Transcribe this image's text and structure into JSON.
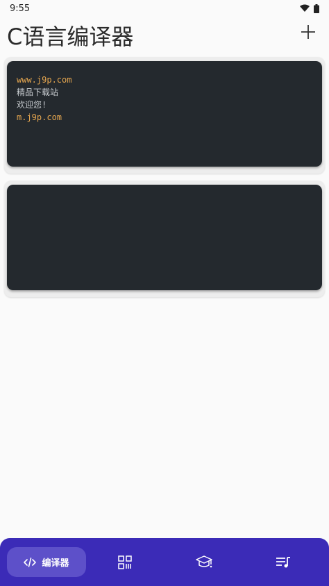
{
  "status_bar": {
    "time": "9:55"
  },
  "header": {
    "title": "C语言编译器"
  },
  "cards": [
    {
      "lines": [
        {
          "text": "www.j9p.com",
          "color": "#e5a64f"
        },
        {
          "text": "精品下载站",
          "color": "#c8ccd0"
        },
        {
          "text": "欢迎您!",
          "color": "#c8ccd0"
        },
        {
          "text": "m.j9p.com",
          "color": "#e5a64f"
        }
      ]
    },
    {
      "lines": []
    }
  ],
  "bottom_nav": {
    "active_label": "编译器",
    "items": [
      {
        "icon": "code-icon",
        "label": "编译器"
      },
      {
        "icon": "grid-icon"
      },
      {
        "icon": "graduation-cap-icon"
      },
      {
        "icon": "playlist-music-icon"
      }
    ],
    "colors": {
      "background": "#3b2bb7",
      "active": "#5d50c9"
    }
  }
}
